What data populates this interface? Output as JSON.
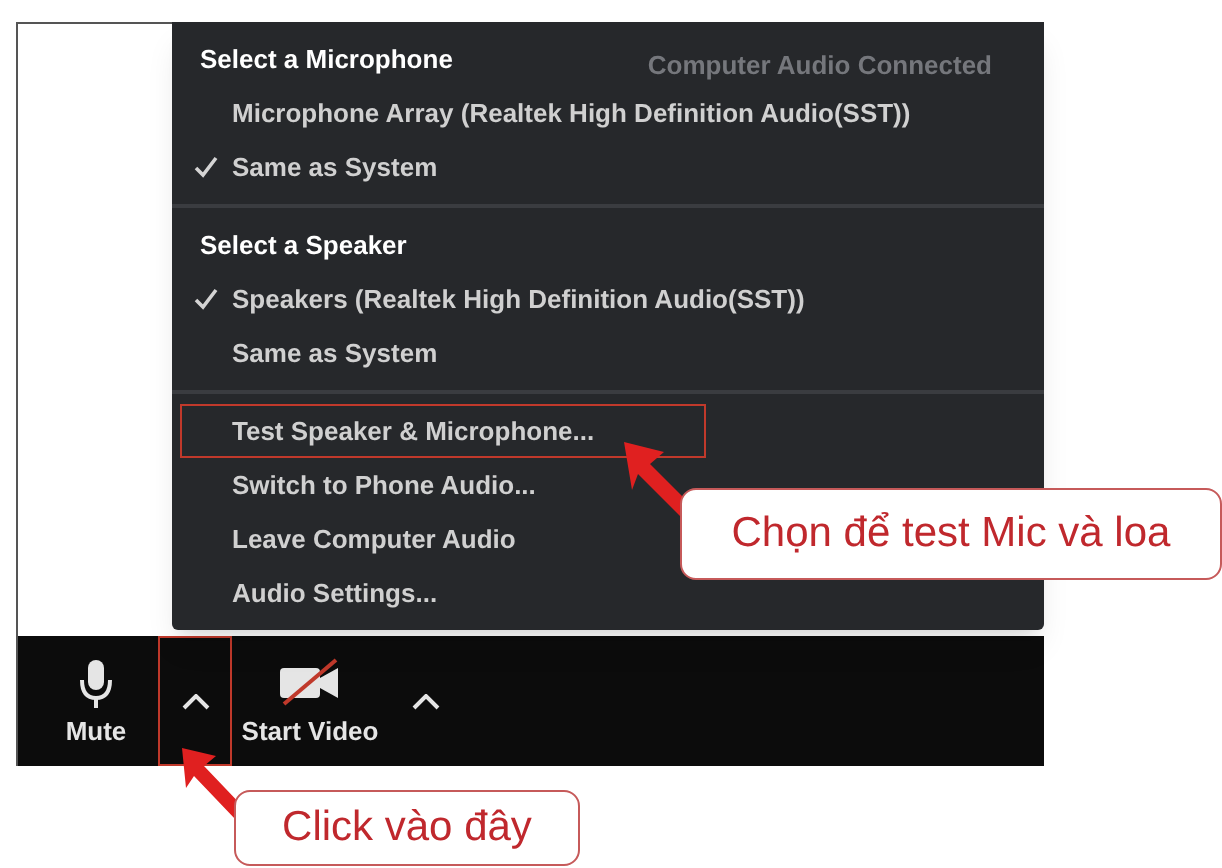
{
  "background_text": "Computer Audio Connected",
  "menu": {
    "sections": [
      {
        "heading": "Select a Microphone",
        "items": [
          {
            "label": "Microphone Array (Realtek High Definition Audio(SST))",
            "checked": false,
            "highlighted": false
          },
          {
            "label": "Same as System",
            "checked": true,
            "highlighted": false
          }
        ]
      },
      {
        "heading": "Select a Speaker",
        "items": [
          {
            "label": "Speakers (Realtek High Definition Audio(SST))",
            "checked": true,
            "highlighted": false
          },
          {
            "label": "Same as System",
            "checked": false,
            "highlighted": false
          }
        ]
      },
      {
        "items": [
          {
            "label": "Test Speaker & Microphone...",
            "checked": false,
            "highlighted": true
          },
          {
            "label": "Switch to Phone Audio...",
            "checked": false,
            "highlighted": false
          },
          {
            "label": "Leave Computer Audio",
            "checked": false,
            "highlighted": false
          },
          {
            "label": "Audio Settings...",
            "checked": false,
            "highlighted": false
          }
        ]
      }
    ]
  },
  "toolbar": {
    "buttons": [
      {
        "kind": "mic",
        "label": "Mute",
        "highlighted": false
      },
      {
        "kind": "caret",
        "highlighted": true
      },
      {
        "kind": "video-off",
        "label": "Start Video",
        "highlighted": false
      },
      {
        "kind": "caret",
        "highlighted": false
      }
    ]
  },
  "callouts": [
    {
      "kind": "menu",
      "text": "Chọn để test Mic và loa"
    },
    {
      "kind": "toolbar",
      "text": "Click vào đây"
    }
  ]
}
